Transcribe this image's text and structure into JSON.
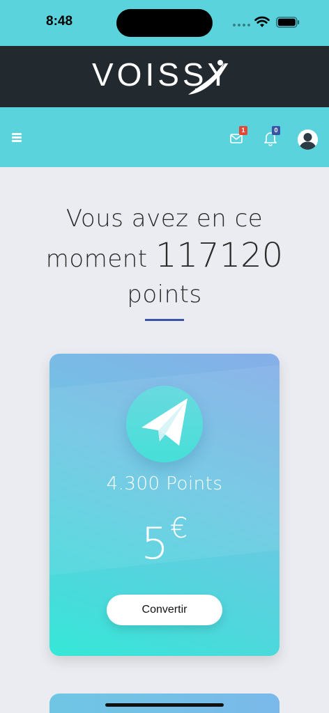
{
  "status_bar": {
    "time": "8:48",
    "bg_color": "#5bd3dc"
  },
  "brand": {
    "logo_text": "VOISSY",
    "bg_color": "#222a30"
  },
  "nav": {
    "menu_icon": "hamburger-icon",
    "mail_icon": "envelope-icon",
    "mail_count": "1",
    "bell_icon": "bell-icon",
    "notification_count": "0",
    "avatar_icon": "user-avatar-icon"
  },
  "headline": {
    "line1": "Vous avez en ce",
    "line2_prefix": "moment",
    "points_value": "117120",
    "line3": "points",
    "accent_color": "#3b55a6"
  },
  "reward_card": {
    "icon": "paper-plane-icon",
    "points_label": "4.300 Points",
    "price_amount": "5",
    "price_currency": "€",
    "button_label": "Convertir"
  }
}
